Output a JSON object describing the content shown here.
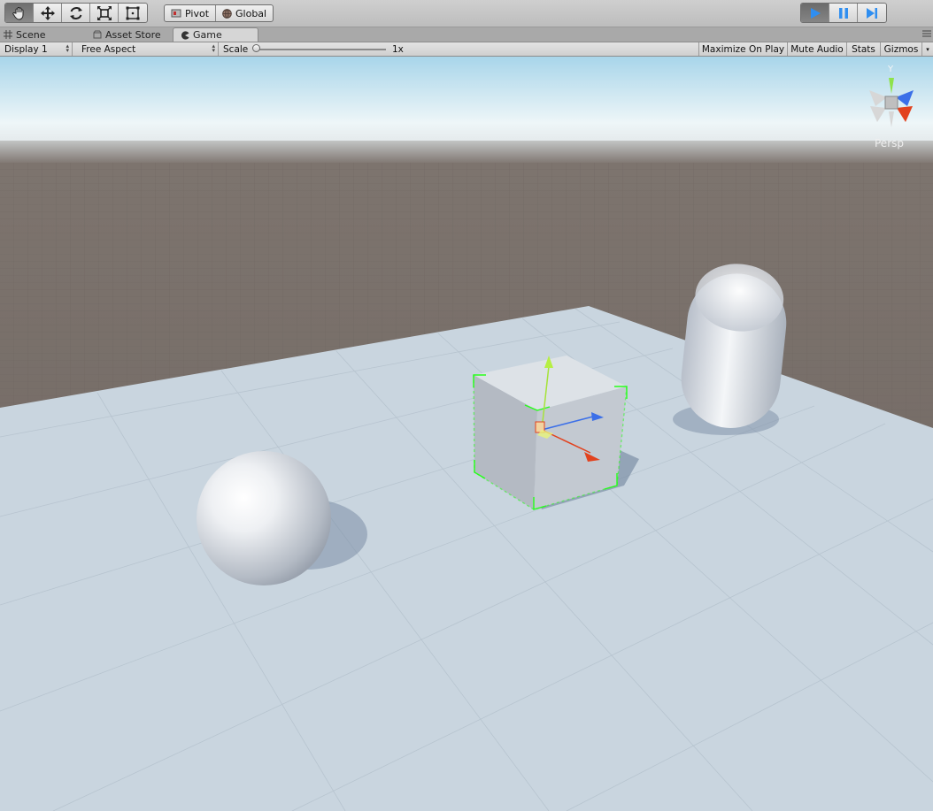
{
  "toolbar": {
    "tools": [
      {
        "icon": "hand-tool-icon",
        "active": true
      },
      {
        "icon": "move-tool-icon",
        "active": false
      },
      {
        "icon": "rotate-tool-icon",
        "active": false
      },
      {
        "icon": "scale-tool-icon",
        "active": false
      },
      {
        "icon": "rect-tool-icon",
        "active": false
      }
    ],
    "pivot_label": "Pivot",
    "global_label": "Global",
    "play_state": "playing"
  },
  "tabs": [
    {
      "label": "Scene",
      "icon": "grid-icon",
      "active": false
    },
    {
      "label": "Asset Store",
      "icon": "store-icon",
      "active": false
    },
    {
      "label": "Game",
      "icon": "pacman-icon",
      "active": true
    }
  ],
  "game_bar": {
    "display": "Display 1",
    "aspect": "Free Aspect",
    "scale_label": "Scale",
    "scale_value": "1x",
    "scale_level": 0.0,
    "maximize_on_play": "Maximize On Play",
    "mute_audio": "Mute Audio",
    "stats": "Stats",
    "gizmos": "Gizmos"
  },
  "viewport": {
    "projection": "Persp",
    "gizmo_axis": "Y",
    "objects": [
      "sphere",
      "cube",
      "capsule",
      "plane"
    ],
    "colors": {
      "sky_top": "#a9d6ec",
      "horizon": "#f2f7f8",
      "ground": "#7a716b",
      "plane": "#c9d5df",
      "selection": "#26ff1a",
      "x_axis": "#e2421e",
      "y_axis": "#a6e33a",
      "z_axis": "#3b6fe8"
    }
  }
}
